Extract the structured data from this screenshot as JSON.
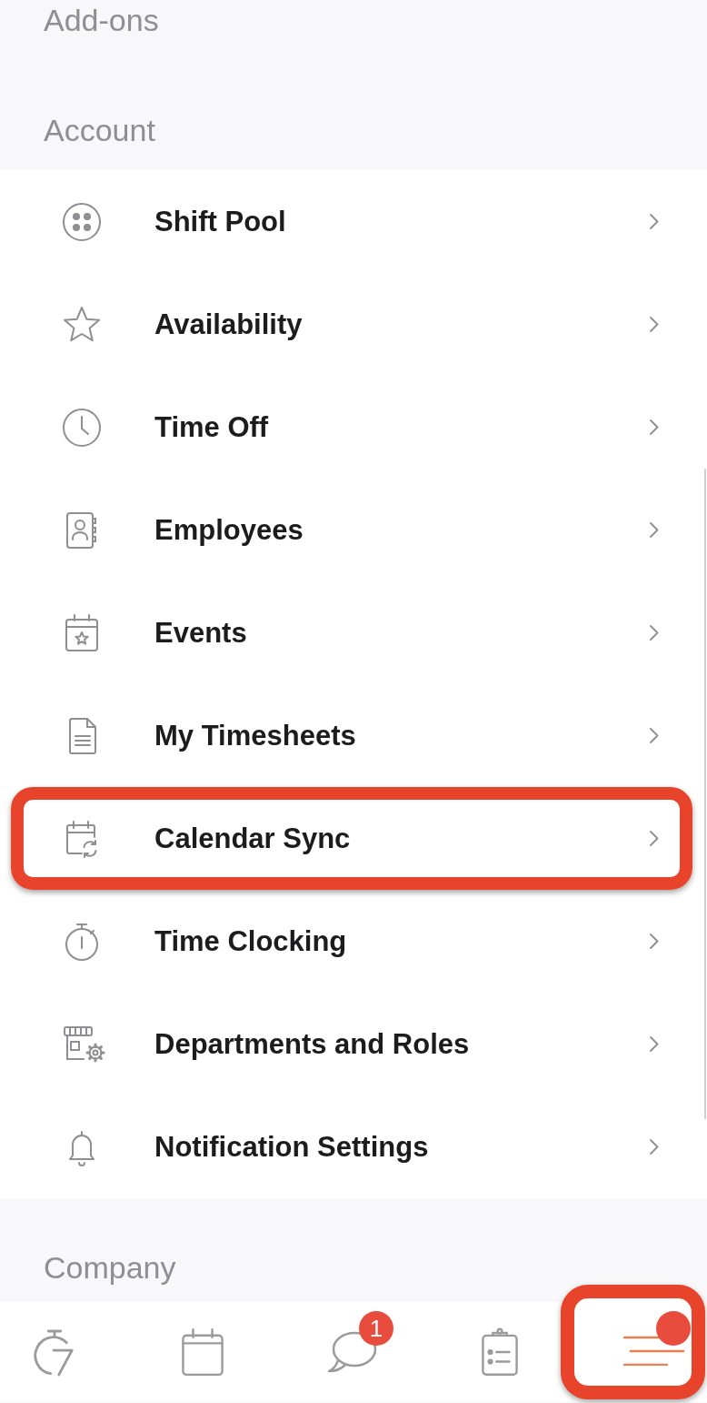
{
  "addons_section": {
    "title": "Add-ons"
  },
  "account_section": {
    "title": "Account",
    "items": [
      {
        "label": "Shift Pool",
        "highlighted": false
      },
      {
        "label": "Availability",
        "highlighted": false
      },
      {
        "label": "Time Off",
        "highlighted": false
      },
      {
        "label": "Employees",
        "highlighted": false
      },
      {
        "label": "Events",
        "highlighted": false
      },
      {
        "label": "My Timesheets",
        "highlighted": false
      },
      {
        "label": "Calendar Sync",
        "highlighted": true
      },
      {
        "label": "Time Clocking",
        "highlighted": false
      },
      {
        "label": "Departments and Roles",
        "highlighted": false
      },
      {
        "label": "Notification Settings",
        "highlighted": false
      }
    ]
  },
  "company_section": {
    "title": "Company"
  },
  "bottom_nav": {
    "tabs": [
      {
        "selected": false,
        "highlighted": false,
        "dot": false
      },
      {
        "selected": false,
        "highlighted": false,
        "dot": false
      },
      {
        "selected": false,
        "highlighted": false,
        "dot": false,
        "badge": "1"
      },
      {
        "selected": false,
        "highlighted": false,
        "dot": false
      },
      {
        "selected": true,
        "highlighted": true,
        "dot": true
      }
    ]
  }
}
